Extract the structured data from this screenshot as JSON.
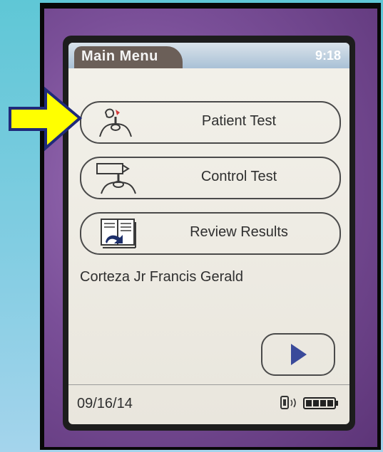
{
  "header": {
    "title": "Main Menu",
    "time": "9:18"
  },
  "menu": [
    {
      "label": "Patient Test",
      "icon": "patient-test-icon"
    },
    {
      "label": "Control Test",
      "icon": "control-test-icon"
    },
    {
      "label": "Review Results",
      "icon": "review-results-icon"
    }
  ],
  "patient_name": "Corteza Jr Francis Gerald",
  "footer": {
    "date": "09/16/14"
  },
  "colors": {
    "arrow": "#ffff00",
    "accent": "#3a4a9a"
  }
}
